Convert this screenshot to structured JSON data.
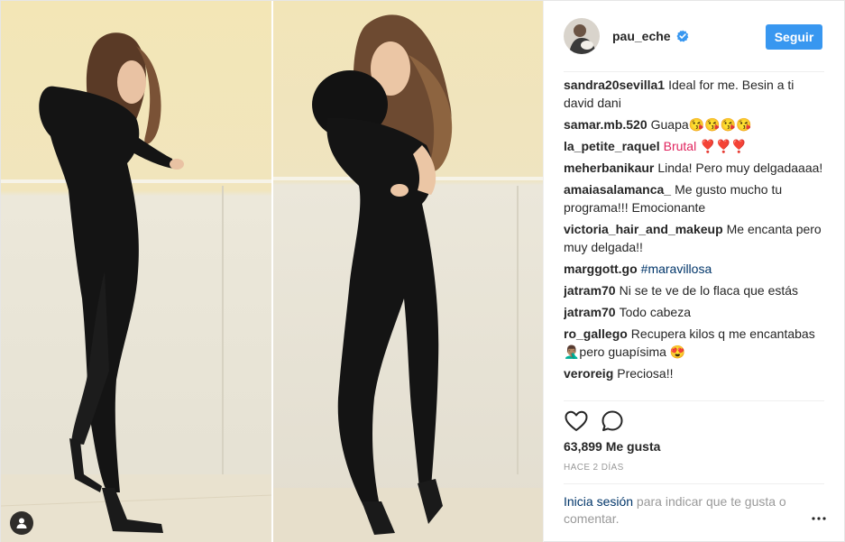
{
  "header": {
    "username": "pau_eche",
    "follow_label": "Seguir"
  },
  "comments": [
    {
      "author": "sandra20sevilla1",
      "text": "Ideal for me. Besin a ti david dani"
    },
    {
      "author": "samar.mb.520",
      "text": "Guapa😘😘😘😘"
    },
    {
      "author": "la_petite_raquel",
      "text": "Brutal ❣️❣️❣️"
    },
    {
      "author": "meherbanikaur",
      "text": "Linda! Pero muy delgadaaaa!"
    },
    {
      "author": "amaiasalamanca_",
      "text": "Me gusto mucho tu programa!!! Emocionante"
    },
    {
      "author": "victoria_hair_and_makeup",
      "text": "Me encanta pero muy delgada!!"
    },
    {
      "author": "marggott.go",
      "text": "#maravillosa"
    },
    {
      "author": "jatram70",
      "text": "Ni se te ve de lo flaca que estás"
    },
    {
      "author": "jatram70",
      "text": "Todo cabeza"
    },
    {
      "author": "ro_gallego",
      "text": "Recupera kilos q me encantabas 🤦🏽‍♂️pero guapísima 😍"
    },
    {
      "author": "veroreig",
      "text": "Preciosa!!"
    }
  ],
  "likes": "63,899 Me gusta",
  "time_ago": "HACE 2 DÍAS",
  "login_prompt": {
    "link": "Inicia sesión",
    "text": " para indicar que te gusta o comentar."
  },
  "colors": {
    "accent": "#3897f0",
    "link": "#003569",
    "muted": "#999999"
  },
  "icons": [
    "heart-icon",
    "comment-icon",
    "verified-badge-icon",
    "user-tag-icon",
    "more-options-icon"
  ]
}
